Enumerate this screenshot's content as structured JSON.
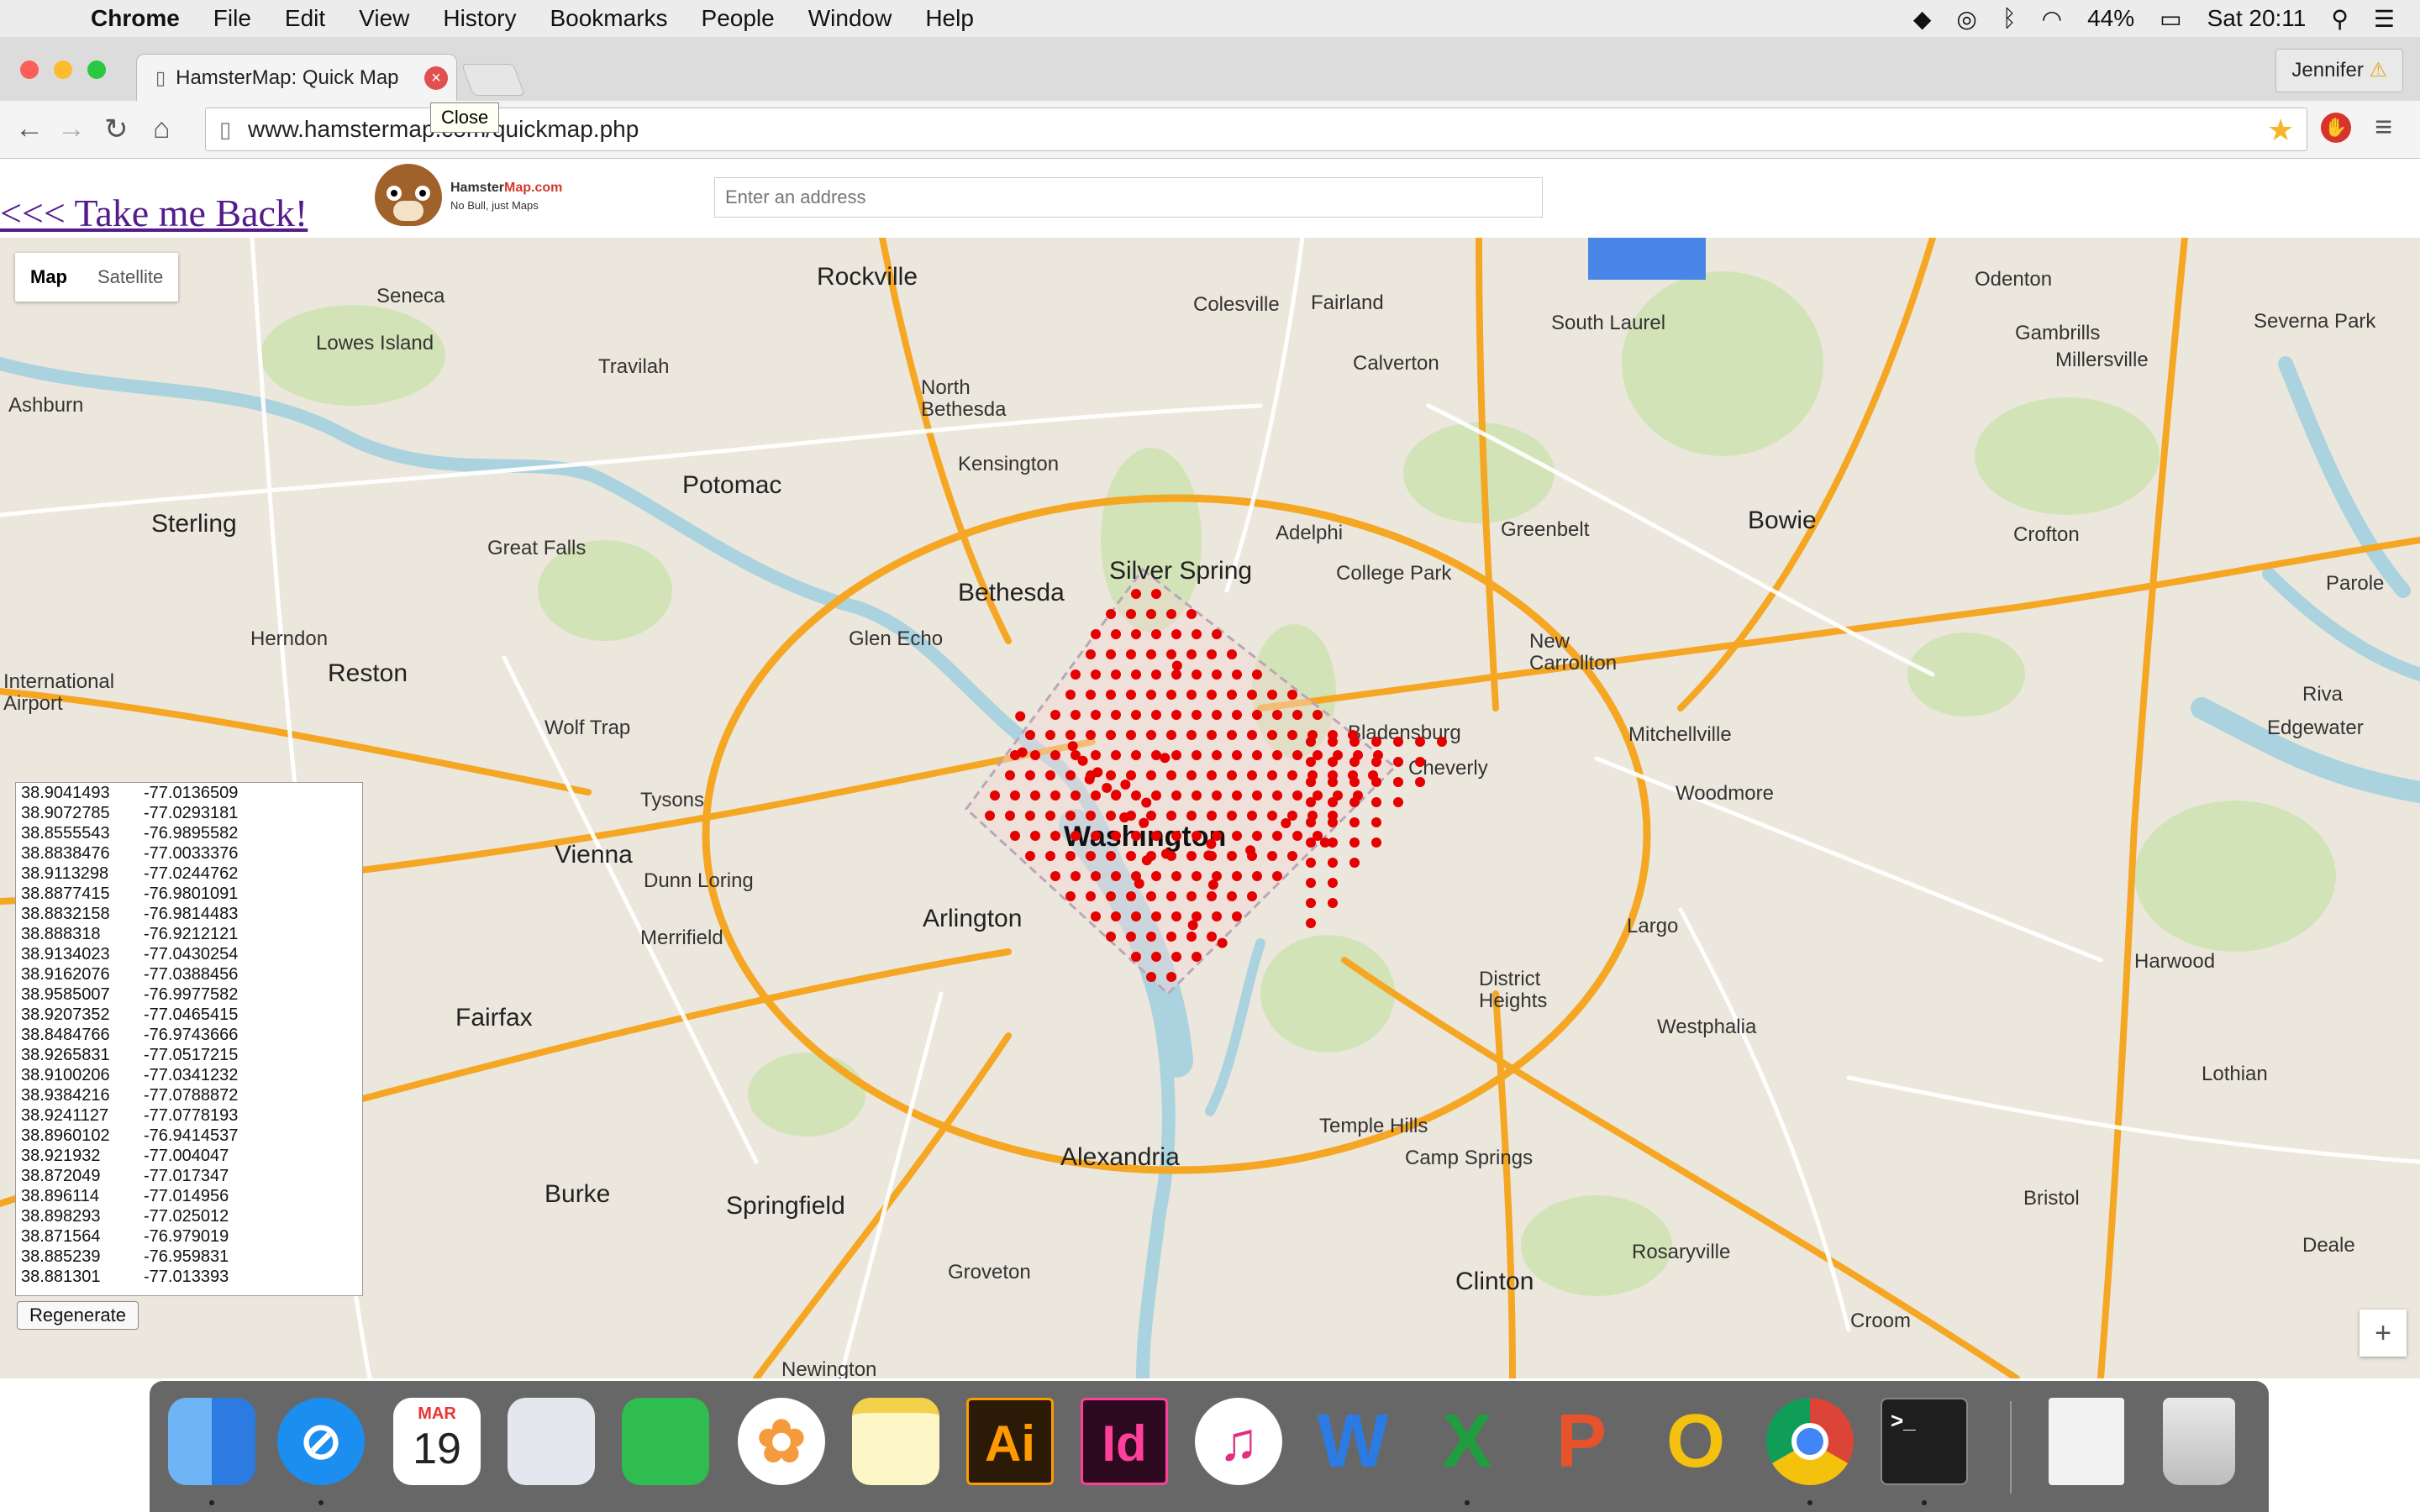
{
  "menubar": {
    "app": "Chrome",
    "items": [
      "File",
      "Edit",
      "View",
      "History",
      "Bookmarks",
      "People",
      "Window",
      "Help"
    ],
    "battery": "44%",
    "clock": "Sat 20:11"
  },
  "browser": {
    "tab_title": "HamsterMap: Quick Map",
    "tooltip": "Close",
    "profile": "Jennifer",
    "url": "www.hamstermap.com/quickmap.php"
  },
  "page": {
    "back_link": "<<< Take me Back!",
    "logo_brand_a": "Hamster",
    "logo_brand_b": "Map.com",
    "logo_tagline": "No Bull, just Maps",
    "address_placeholder": "Enter an address",
    "map_type": {
      "map": "Map",
      "satellite": "Satellite"
    },
    "regenerate": "Regenerate",
    "zoom_in": "+"
  },
  "coords": [
    [
      "38.9041493",
      "-77.0136509"
    ],
    [
      "38.9072785",
      "-77.0293181"
    ],
    [
      "38.8555543",
      "-76.9895582"
    ],
    [
      "38.8838476",
      "-77.0033376"
    ],
    [
      "38.9113298",
      "-77.0244762"
    ],
    [
      "38.8877415",
      "-76.9801091"
    ],
    [
      "38.8832158",
      "-76.9814483"
    ],
    [
      "38.888318",
      "-76.9212121"
    ],
    [
      "38.9134023",
      "-77.0430254"
    ],
    [
      "38.9162076",
      "-77.0388456"
    ],
    [
      "38.9585007",
      "-76.9977582"
    ],
    [
      "38.9207352",
      "-77.0465415"
    ],
    [
      "38.8484766",
      "-76.9743666"
    ],
    [
      "38.9265831",
      "-77.0517215"
    ],
    [
      "38.9100206",
      "-77.0341232"
    ],
    [
      "38.9384216",
      "-77.0788872"
    ],
    [
      "38.9241127",
      "-77.0778193"
    ],
    [
      "38.8960102",
      "-76.9414537"
    ],
    [
      "38.921932",
      "-77.004047"
    ],
    [
      "38.872049",
      "-77.017347"
    ],
    [
      "38.896114",
      "-77.014956"
    ],
    [
      "38.898293",
      "-77.025012"
    ],
    [
      "38.871564",
      "-76.979019"
    ],
    [
      "38.885239",
      "-76.959831"
    ],
    [
      "38.881301",
      "-77.013393"
    ]
  ],
  "map_labels": [
    {
      "text": "Rockville",
      "size": "big"
    },
    {
      "text": "Colesville",
      "size": "normal"
    },
    {
      "text": "Fairland",
      "size": "normal"
    },
    {
      "text": "South Laurel",
      "size": "normal"
    },
    {
      "text": "Odenton",
      "size": "normal"
    },
    {
      "text": "Severna Park",
      "size": "normal"
    },
    {
      "text": "Seneca",
      "size": "normal"
    },
    {
      "text": "Lowes Island",
      "size": "normal"
    },
    {
      "text": "Travilah",
      "size": "normal"
    },
    {
      "text": "North Bethesda",
      "size": "normal"
    },
    {
      "text": "Calverton",
      "size": "normal"
    },
    {
      "text": "Gambrills",
      "size": "normal"
    },
    {
      "text": "Millersville",
      "size": "normal"
    },
    {
      "text": "Ashburn",
      "size": "normal"
    },
    {
      "text": "Kensington",
      "size": "normal"
    },
    {
      "text": "Potomac",
      "size": "big"
    },
    {
      "text": "Sterling",
      "size": "big"
    },
    {
      "text": "Great Falls",
      "size": "normal"
    },
    {
      "text": "Adelphi",
      "size": "normal"
    },
    {
      "text": "Greenbelt",
      "size": "normal"
    },
    {
      "text": "Bowie",
      "size": "big"
    },
    {
      "text": "Crofton",
      "size": "normal"
    },
    {
      "text": "Silver Spring",
      "size": "big"
    },
    {
      "text": "College Park",
      "size": "normal"
    },
    {
      "text": "Bethesda",
      "size": "big"
    },
    {
      "text": "Parole",
      "size": "normal"
    },
    {
      "text": "Herndon",
      "size": "normal"
    },
    {
      "text": "Reston",
      "size": "big"
    },
    {
      "text": "Glen Echo",
      "size": "normal"
    },
    {
      "text": "New Carrollton",
      "size": "normal"
    },
    {
      "text": "International Airport",
      "size": "normal"
    },
    {
      "text": "Wolf Trap",
      "size": "normal"
    },
    {
      "text": "Bladensburg",
      "size": "normal"
    },
    {
      "text": "Mitchellville",
      "size": "normal"
    },
    {
      "text": "Riva",
      "size": "normal"
    },
    {
      "text": "Edgewater",
      "size": "normal"
    },
    {
      "text": "Cheverly",
      "size": "normal"
    },
    {
      "text": "Woodmore",
      "size": "normal"
    },
    {
      "text": "Tysons",
      "size": "normal"
    },
    {
      "text": "Washington",
      "size": "huge"
    },
    {
      "text": "Vienna",
      "size": "big"
    },
    {
      "text": "Dunn Loring",
      "size": "normal"
    },
    {
      "text": "Arlington",
      "size": "big"
    },
    {
      "text": "Largo",
      "size": "normal"
    },
    {
      "text": "Merrifield",
      "size": "normal"
    },
    {
      "text": "Harwood",
      "size": "normal"
    },
    {
      "text": "District Heights",
      "size": "normal"
    },
    {
      "text": "Fairfax",
      "size": "big"
    },
    {
      "text": "Westphalia",
      "size": "normal"
    },
    {
      "text": "Lothian",
      "size": "normal"
    },
    {
      "text": "Temple Hills",
      "size": "normal"
    },
    {
      "text": "Alexandria",
      "size": "big"
    },
    {
      "text": "Camp Springs",
      "size": "normal"
    },
    {
      "text": "Burke",
      "size": "big"
    },
    {
      "text": "Springfield",
      "size": "big"
    },
    {
      "text": "Rosaryville",
      "size": "normal"
    },
    {
      "text": "Bristol",
      "size": "normal"
    },
    {
      "text": "Deale",
      "size": "normal"
    },
    {
      "text": "Groveton",
      "size": "normal"
    },
    {
      "text": "Clinton",
      "size": "big"
    },
    {
      "text": "Croom",
      "size": "normal"
    },
    {
      "text": "Newington",
      "size": "normal"
    }
  ],
  "dock_apps": [
    "Finder",
    "Safari",
    "Calendar",
    "Preview",
    "FaceTime",
    "Photos",
    "Notes",
    "Illustrator",
    "InDesign",
    "iTunes",
    "Word",
    "Excel",
    "PowerPoint",
    "Outlook",
    "Chrome",
    "Terminal",
    "Document",
    "Trash"
  ],
  "dock_labels": {
    "calendar_month": "MAR",
    "calendar_day": "19",
    "illustrator": "Ai",
    "indesign": "Id",
    "word": "W",
    "excel": "X",
    "powerpoint": "P",
    "outlook": "O",
    "terminal": ">_"
  },
  "colors": {
    "marker": "#e60000",
    "road_major": "#f5a623",
    "water": "#aad3df",
    "park": "#cfe3b3",
    "link_visited": "#551a8b"
  }
}
